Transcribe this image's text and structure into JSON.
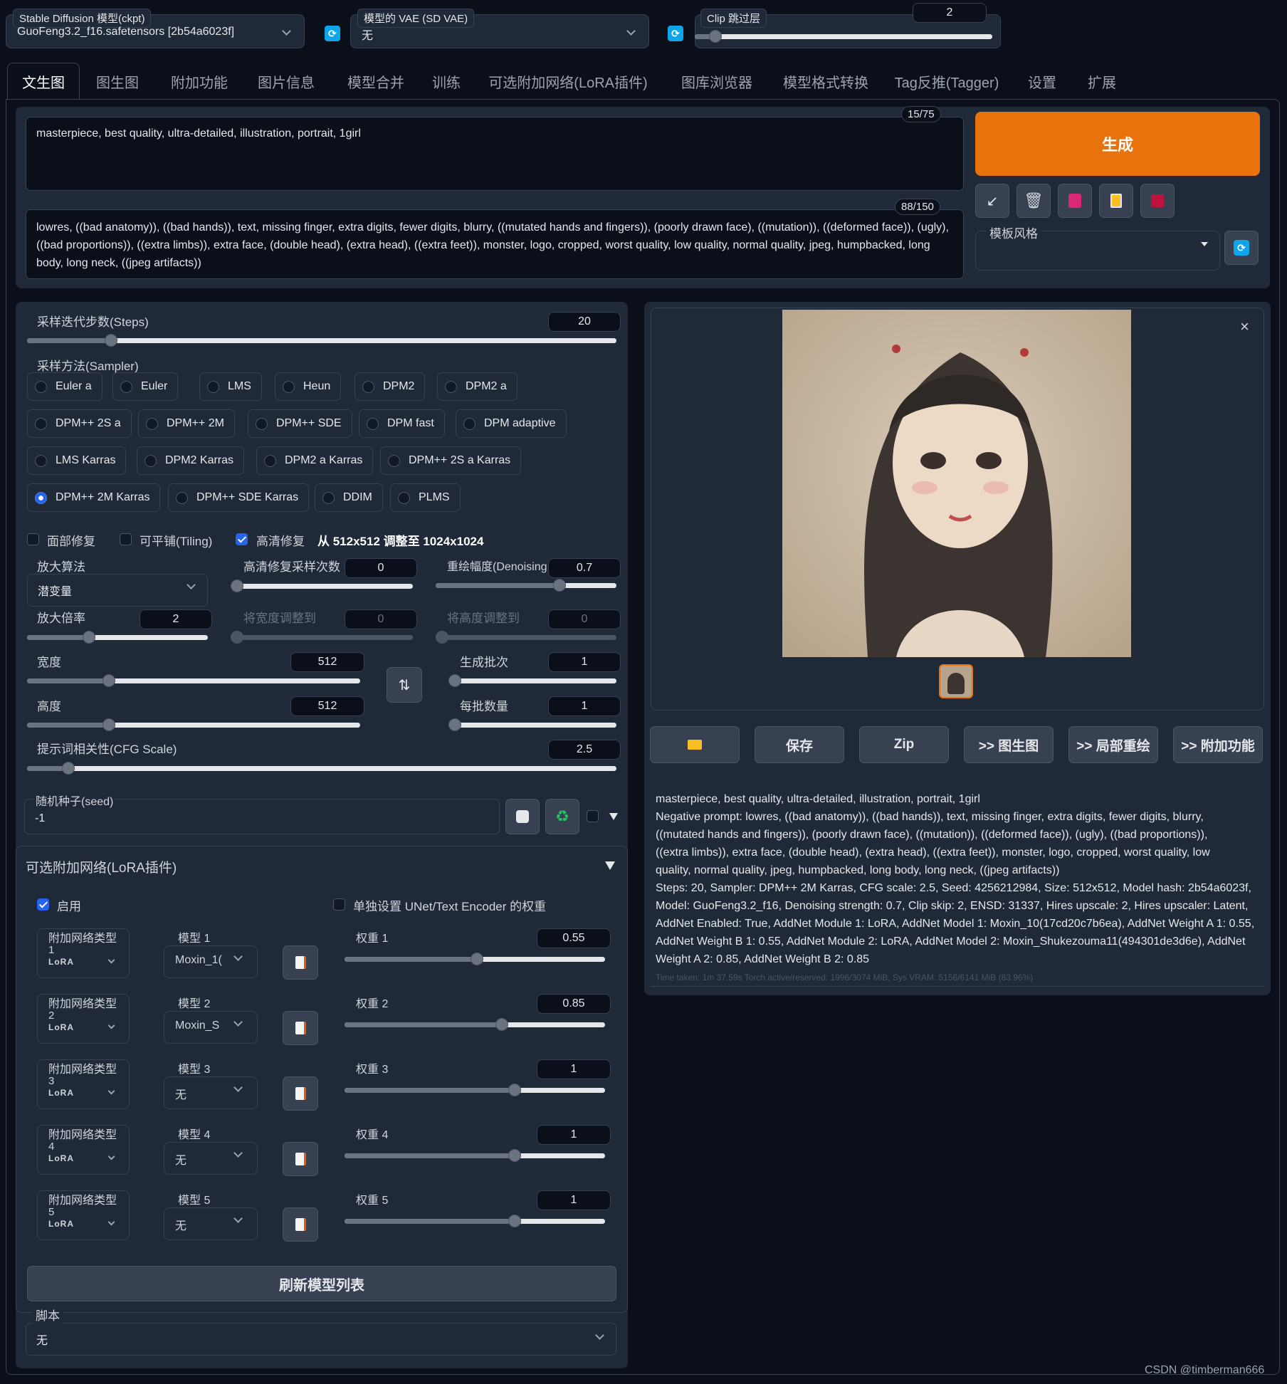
{
  "top": {
    "ckpt_label": "Stable Diffusion 模型(ckpt)",
    "ckpt_value": "GuoFeng3.2_f16.safetensors [2b54a6023f]",
    "vae_label": "模型的 VAE (SD VAE)",
    "vae_value": "无",
    "clip_label": "Clip 跳过层",
    "clip_value": "2",
    "clip_fraction": 0.05
  },
  "tabs": [
    "文生图",
    "图生图",
    "附加功能",
    "图片信息",
    "模型合并",
    "训练",
    "可选附加网络(LoRA插件)",
    "图库浏览器",
    "模型格式转换",
    "Tag反推(Tagger)",
    "设置",
    "扩展"
  ],
  "prompt": {
    "positive": "masterpiece, best quality, ultra-detailed, illustration, portrait, 1girl",
    "positive_count": "15/75",
    "negative": "lowres, ((bad anatomy)), ((bad hands)), text, missing finger, extra digits, fewer digits, blurry, ((mutated hands and fingers)), (poorly drawn face), ((mutation)), ((deformed face)), (ugly), ((bad proportions)), ((extra limbs)), extra face, (double head), (extra head), ((extra feet)), monster, logo, cropped, worst quality, low quality, normal quality, jpeg, humpbacked, long body, long neck, ((jpeg artifacts))",
    "negative_count": "88/150"
  },
  "actions": {
    "generate": "生成",
    "style_label": "模板风格"
  },
  "params": {
    "steps_label": "采样迭代步数(Steps)",
    "steps_value": "20",
    "steps_fraction": 0.135,
    "sampler_label": "采样方法(Sampler)",
    "samplers": [
      [
        "Euler a",
        "Euler",
        "LMS",
        "Heun",
        "DPM2",
        "DPM2 a"
      ],
      [
        "DPM++ 2S a",
        "DPM++ 2M",
        "DPM++ SDE",
        "DPM fast",
        "DPM adaptive"
      ],
      [
        "LMS Karras",
        "DPM2 Karras",
        "DPM2 a Karras",
        "DPM++ 2S a Karras"
      ],
      [
        "DPM++ 2M Karras",
        "DPM++ SDE Karras",
        "DDIM",
        "PLMS"
      ]
    ],
    "sampler_selected": "DPM++ 2M Karras",
    "face_restore": "面部修复",
    "tiling": "可平铺(Tiling)",
    "hires": "高清修复",
    "hires_note": "从 512x512 调整至 1024x1024",
    "upscaler_label": "放大算法",
    "upscaler_value": "潜变量",
    "hires_steps_label": "高清修复采样次数",
    "hires_steps_value": "0",
    "hires_steps_fraction": 0.0,
    "denoise_label": "重绘幅度(Denoising",
    "denoise_value": "0.7",
    "denoise_fraction": 0.7,
    "scale_label": "放大倍率",
    "scale_value": "2",
    "scale_fraction": 0.33,
    "resize_w_label": "将宽度调整到",
    "resize_w_value": "0",
    "resize_h_label": "将高度调整到",
    "resize_h_value": "0",
    "width_label": "宽度",
    "width_value": "512",
    "width_fraction": 0.235,
    "height_label": "高度",
    "height_value": "512",
    "height_fraction": 0.235,
    "batch_count_label": "生成批次",
    "batch_count_value": "1",
    "batch_size_label": "每批数量",
    "batch_size_value": "1",
    "cfg_label": "提示词相关性(CFG Scale)",
    "cfg_value": "2.5",
    "cfg_fraction": 0.06,
    "seed_label": "随机种子(seed)",
    "seed_value": "-1"
  },
  "lora": {
    "title": "可选附加网络(LoRA插件)",
    "enable": "启用",
    "separate": "单独设置 UNet/Text Encoder 的权重",
    "rows": [
      {
        "type_label": "附加网络类型",
        "idx": "1",
        "type_value": "LoRA",
        "model_label": "模型 1",
        "model_value": "Moxin_1(",
        "weight_label": "权重 1",
        "weight_value": "0.55",
        "weight_fraction": 0.51
      },
      {
        "type_label": "附加网络类型",
        "idx": "2",
        "type_value": "LoRA",
        "model_label": "模型 2",
        "model_value": "Moxin_S",
        "weight_label": "权重 2",
        "weight_value": "0.85",
        "weight_fraction": 0.61
      },
      {
        "type_label": "附加网络类型",
        "idx": "3",
        "type_value": "LoRA",
        "model_label": "模型 3",
        "model_value": "无",
        "weight_label": "权重 3",
        "weight_value": "1",
        "weight_fraction": 0.66
      },
      {
        "type_label": "附加网络类型",
        "idx": "4",
        "type_value": "LoRA",
        "model_label": "模型 4",
        "model_value": "无",
        "weight_label": "权重 4",
        "weight_value": "1",
        "weight_fraction": 0.66
      },
      {
        "type_label": "附加网络类型",
        "idx": "5",
        "type_value": "LoRA",
        "model_label": "模型 5",
        "model_value": "无",
        "weight_label": "权重 5",
        "weight_value": "1",
        "weight_fraction": 0.66
      }
    ],
    "refresh": "刷新模型列表"
  },
  "script": {
    "label": "脚本",
    "value": "无"
  },
  "output": {
    "buttons": [
      "保存",
      "Zip",
      ">> 图生图",
      ">> 局部重绘",
      ">> 附加功能"
    ],
    "info_lines": [
      "masterpiece, best quality, ultra-detailed, illustration, portrait, 1girl",
      "Negative prompt: lowres, ((bad anatomy)), ((bad hands)), text, missing finger, extra digits, fewer digits, blurry,",
      "((mutated hands and fingers)), (poorly drawn face), ((mutation)), ((deformed face)), (ugly), ((bad proportions)),",
      "((extra limbs)), extra face, (double head), (extra head), ((extra feet)), monster, logo, cropped, worst quality, low",
      "quality, normal quality, jpeg, humpbacked, long body, long neck, ((jpeg artifacts))",
      "Steps: 20, Sampler: DPM++ 2M Karras, CFG scale: 2.5, Seed: 4256212984, Size: 512x512, Model hash: 2b54a6023f,",
      "Model: GuoFeng3.2_f16, Denoising strength: 0.7, Clip skip: 2, ENSD: 31337, Hires upscale: 2, Hires upscaler: Latent,",
      "AddNet Enabled: True, AddNet Module 1: LoRA, AddNet Model 1: Moxin_10(17cd20c7b6ea), AddNet Weight A 1: 0.55,",
      "AddNet Weight B 1: 0.55, AddNet Module 2: LoRA, AddNet Model 2: Moxin_Shukezouma11(494301de3d6e), AddNet",
      "Weight A 2: 0.85, AddNet Weight B 2: 0.85"
    ],
    "time_taken": "Time taken: 1m 37.59s  Torch active/reserved: 1996/3074 MiB, Sys VRAM: 5156/6141 MiB (83.96%)"
  },
  "watermark": "CSDN @timberman666",
  "colors": {
    "generate": "#e8730c",
    "accent": "#2563eb",
    "refresh": "#0ea5e9"
  }
}
